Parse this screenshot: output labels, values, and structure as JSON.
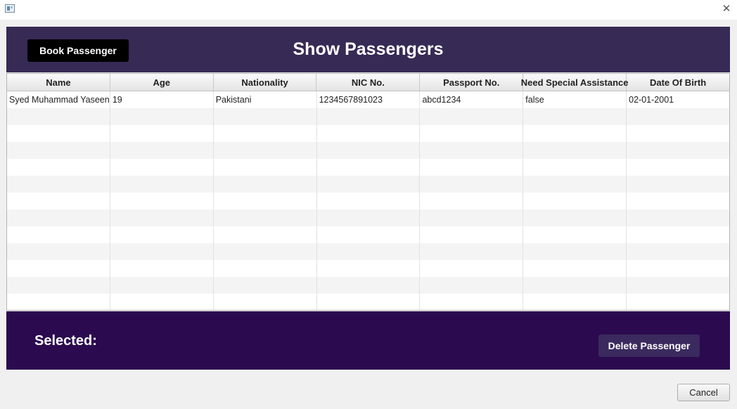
{
  "window": {
    "close_glyph": "✕",
    "icon": "app-window-icon"
  },
  "header": {
    "book_label": "Book Passenger",
    "title": "Show Passengers",
    "background": "#372a55"
  },
  "table": {
    "columns": [
      "Name",
      "Age",
      "Nationality",
      "NIC No.",
      "Passport No.",
      "Need Special Assistance",
      "Date Of Birth"
    ],
    "rows": [
      [
        "Syed Muhammad Yaseen",
        "19",
        "Pakistani",
        "1234567891023",
        "abcd1234",
        "false",
        "02-01-2001"
      ]
    ]
  },
  "footer": {
    "selected_label": "Selected:",
    "delete_label": "Delete Passenger",
    "background": "#2b0a4f"
  },
  "dialog": {
    "cancel_label": "Cancel"
  }
}
